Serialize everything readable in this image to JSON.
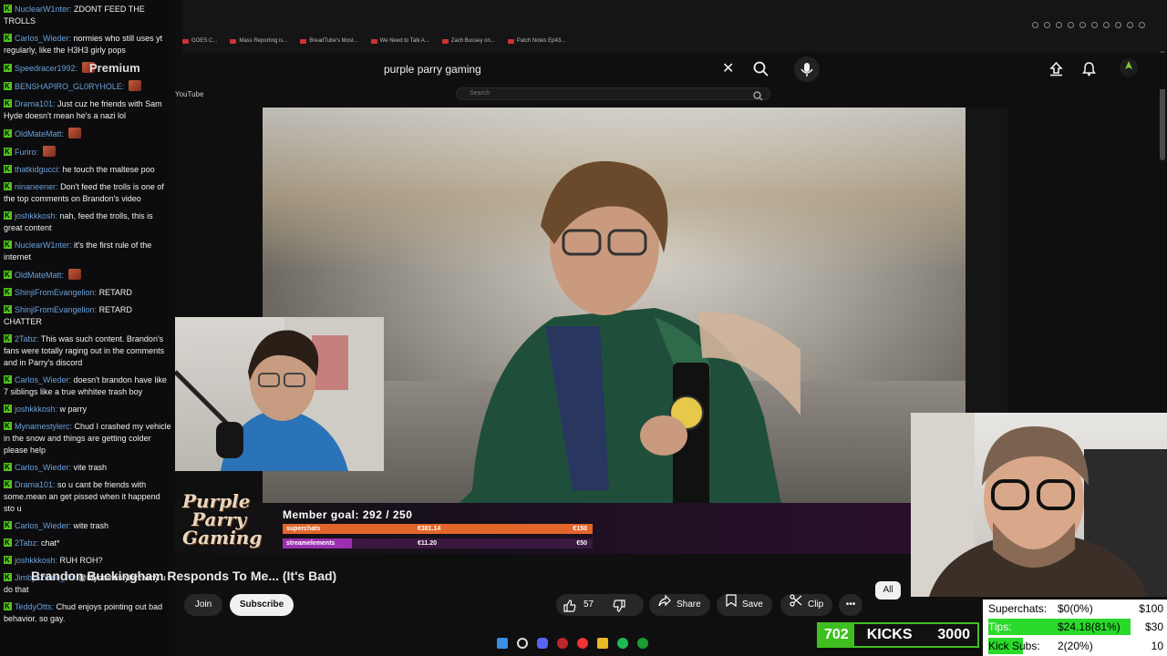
{
  "browser": {
    "bookmarks": [
      "GOES C...",
      "Mass Reporting is...",
      "BreadTube's Most...",
      "We Need to Talk A...",
      "Zach Bussey on...",
      "Patch Notes Ep43..."
    ]
  },
  "youtube": {
    "search_query": "purple parry gaming",
    "small_search_placeholder": "Search",
    "logo_text": "YouTube",
    "premium_text": "Premium",
    "video_title": "Brandon Buckingham Responds To Me... (It's Bad)",
    "join_label": "Join",
    "subscribe_label": "Subscribe",
    "like_count": "57",
    "share_label": "Share",
    "save_label": "Save",
    "clip_label": "Clip",
    "all_chip": "All"
  },
  "overlay": {
    "logo_lines": [
      "Purple",
      "Parry",
      "Gaming"
    ],
    "member_goal": "Member goal: 292 / 250",
    "superchats": {
      "label": "superchats",
      "current": "€381.14",
      "goal": "€150",
      "fill": 1.0,
      "color": "#e2662a"
    },
    "streamelements": {
      "label": "streamelements",
      "current": "€11.20",
      "goal": "€50",
      "fill": 0.224,
      "color": "#9b2fb0"
    }
  },
  "chat": [
    {
      "user": "NuclearW1nter",
      "text": "ZDONT FEED THE TROLLS"
    },
    {
      "user": "Carlos_Wieder",
      "text": "normies who still uses yt regularly, like the H3H3 girly pops"
    },
    {
      "user": "Speedracer1992",
      "text": "",
      "emote": true
    },
    {
      "user": "BENSHAPIRO_GL0RYHOLE",
      "text": "",
      "emote": true
    },
    {
      "user": "Drama101",
      "text": "Just cuz he friends with Sam Hyde doesn't mean he's a nazi lol"
    },
    {
      "user": "OldMateMatt",
      "text": "",
      "emote": true
    },
    {
      "user": "Furiro",
      "text": "",
      "emote": true
    },
    {
      "user": "thatkidgucci",
      "text": "he touch the maltese poo"
    },
    {
      "user": "ninaneener",
      "text": "Don't feed the trolls is one of the top comments on Brandon's video"
    },
    {
      "user": "joshkkkosh",
      "text": "nah, feed the trolls, this is great content"
    },
    {
      "user": "NuclearW1nter",
      "text": "it's the first rule of the internet"
    },
    {
      "user": "OldMateMatt",
      "text": "",
      "emote": true
    },
    {
      "user": "ShinjiFromEvangelion",
      "text": "RETARD"
    },
    {
      "user": "ShinjiFromEvangelion",
      "text": "RETARD CHATTER"
    },
    {
      "user": "2Tabz",
      "text": "This was such content. Brandon's fans were totally raging out in the comments and in Parry's discord"
    },
    {
      "user": "Carlos_Wieder",
      "text": "doesn't brandon have like 7 siblings like a true whhitee trash boy"
    },
    {
      "user": "joshkkkosh",
      "text": "w parry"
    },
    {
      "user": "Mynamestylerc",
      "text": "Chud I crashed my vehicle in the snow and things are getting colder please help"
    },
    {
      "user": "Carlos_Wieder",
      "text": "vite trash"
    },
    {
      "user": "Drama101",
      "text": "so u cant be friends with some.mean an get pissed when it happend sto u"
    },
    {
      "user": "Carlos_Wieder",
      "text": "wite trash"
    },
    {
      "user": "2Tabz",
      "text": "chat*"
    },
    {
      "user": "joshkkkosh",
      "text": "RUH ROH?"
    },
    {
      "user": "JimbyCoffee_Tri",
      "text": "@Mynamestylerc why u do that"
    },
    {
      "user": "TeddyOtts",
      "text": "Chud enjoys pointing out bad behavior. so gay."
    }
  ],
  "kicks": {
    "count": "702",
    "label": "KICKS",
    "goal": "3000"
  },
  "goals": [
    {
      "label": "Superchats:",
      "value": "$0(0%)",
      "target": "$100",
      "fill": 0.0
    },
    {
      "label": "Tips:",
      "value": "$24.18(81%)",
      "target": "$30",
      "fill": 0.81
    },
    {
      "label": "Kick Subs:",
      "value": "2(20%)",
      "target": "10",
      "fill": 0.2
    }
  ],
  "colors": {
    "kick_green": "#3fbf1f",
    "goal_green": "#2bd92b",
    "chat_user": "#6aa0d8"
  }
}
